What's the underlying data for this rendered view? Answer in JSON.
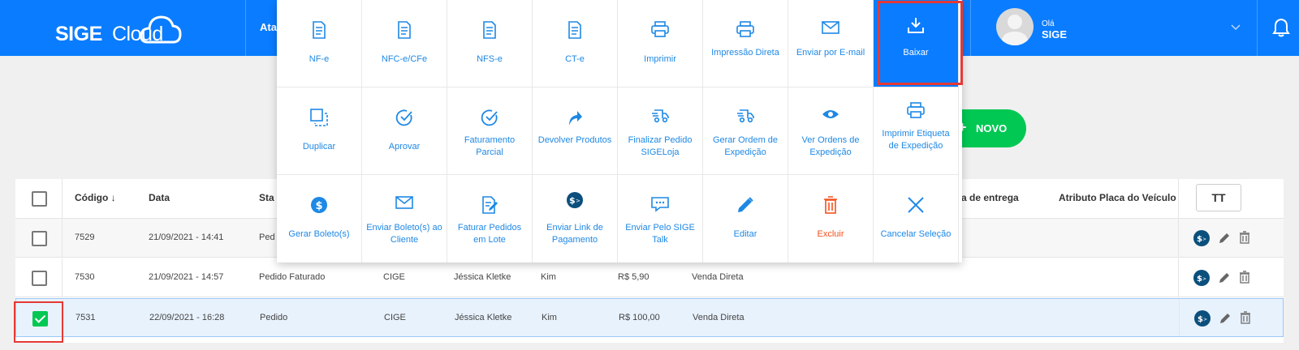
{
  "header": {
    "logo_sige": "SIGE",
    "logo_cloud": "Cloud",
    "nav_partial": "Ata",
    "user_greeting": "Olá",
    "user_name": "SIGE"
  },
  "toolbar": {
    "new_label": "NOVO",
    "columns_label": "TT"
  },
  "table": {
    "headers": {
      "code": "Código ↓",
      "date": "Data",
      "status_partial": "Sta",
      "delivery_partial": "a de entrega",
      "plate": "Atributo Placa do Veículo"
    },
    "rows": [
      {
        "code": "7529",
        "date": "21/09/2021 - 14:41",
        "status": "Ped",
        "company": "",
        "seller": "",
        "client": "",
        "value": "",
        "type": "",
        "checked": false
      },
      {
        "code": "7530",
        "date": "21/09/2021 - 14:57",
        "status": "Pedido Faturado",
        "company": "CIGE",
        "seller": "Jéssica Kletke",
        "client": "Kim",
        "value": "R$  5,90",
        "type": "Venda Direta",
        "checked": false
      },
      {
        "code": "7531",
        "date": "22/09/2021 - 16:28",
        "status": "Pedido",
        "company": "CIGE",
        "seller": "Jéssica Kletke",
        "client": "Kim",
        "value": "R$  100,00",
        "type": "Venda Direta",
        "checked": true
      }
    ]
  },
  "menu": {
    "items": [
      {
        "label": "NF-e",
        "icon": "document-icon"
      },
      {
        "label": "NFC-e/CFe",
        "icon": "document-icon"
      },
      {
        "label": "NFS-e",
        "icon": "document-icon"
      },
      {
        "label": "CT-e",
        "icon": "document-icon"
      },
      {
        "label": "Imprimir",
        "icon": "printer-icon"
      },
      {
        "label": "Impressão Direta",
        "icon": "printer-icon"
      },
      {
        "label": "Enviar por E-mail",
        "icon": "envelope-icon"
      },
      {
        "label": "Baixar",
        "icon": "download-icon"
      },
      {
        "label": "Duplicar",
        "icon": "duplicate-icon"
      },
      {
        "label": "Aprovar",
        "icon": "check-circle-icon"
      },
      {
        "label": "Faturamento Parcial",
        "icon": "check-circle-icon"
      },
      {
        "label": "Devolver Produtos",
        "icon": "return-arrow-icon"
      },
      {
        "label": "Finalizar Pedido SIGELoja",
        "icon": "truck-icon"
      },
      {
        "label": "Gerar Ordem de Expedição",
        "icon": "truck-icon"
      },
      {
        "label": "Ver Ordens de Expedição",
        "icon": "eye-icon"
      },
      {
        "label": "Imprimir Etiqueta de Expedição",
        "icon": "printer-icon"
      },
      {
        "label": "Gerar Boleto(s)",
        "icon": "dollar-icon"
      },
      {
        "label": "Enviar Boleto(s) ao Cliente",
        "icon": "envelope-icon"
      },
      {
        "label": "Faturar Pedidos em Lote",
        "icon": "batch-edit-icon"
      },
      {
        "label": "Enviar Link de Pagamento",
        "icon": "payment-link-icon"
      },
      {
        "label": "Enviar Pelo SIGE Talk",
        "icon": "chat-icon"
      },
      {
        "label": "Editar",
        "icon": "pencil-icon"
      },
      {
        "label": "Excluir",
        "icon": "trash-icon"
      },
      {
        "label": "Cancelar Seleção",
        "icon": "close-icon"
      }
    ]
  },
  "colors": {
    "brand_blue": "#0a7cff",
    "menu_text": "#1e88e5",
    "danger": "#f4511e",
    "success": "#00c853",
    "highlight": "#e53935"
  }
}
